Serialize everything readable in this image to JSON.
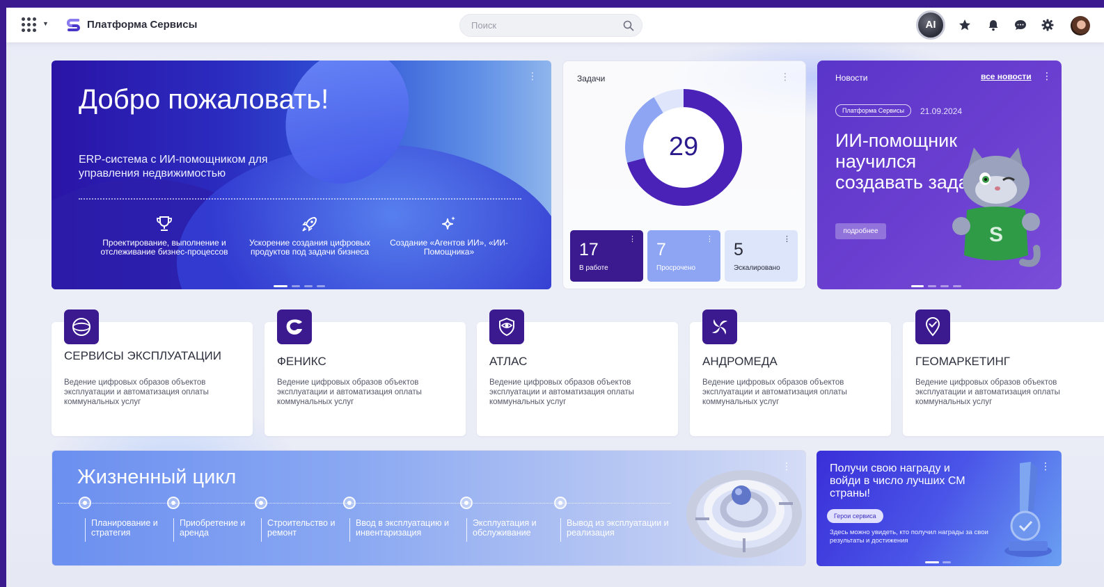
{
  "header": {
    "brand_name": "Платформа Сервисы",
    "search_placeholder": "Поиск",
    "ai_label": "AI",
    "icons": [
      "apps-grid-icon",
      "star-icon",
      "bell-icon",
      "chat-icon",
      "gear-icon"
    ]
  },
  "hero": {
    "title": "Добро пожаловать!",
    "subtitle": "ERP-система с ИИ-помощником для управления недвижимостью",
    "features": [
      {
        "icon": "trophy-icon",
        "label": "Проектирование, выполнение и отслеживание бизнес-процессов"
      },
      {
        "icon": "rocket-icon",
        "label": "Ускорение создания цифровых продуктов под задачи бизнеса"
      },
      {
        "icon": "sparkle-icon",
        "label": "Создание «Агентов ИИ», «ИИ-Помощника»"
      }
    ],
    "slides": 4,
    "active_slide": 1
  },
  "tasks": {
    "title": "Задачи",
    "total": "29",
    "stats": [
      {
        "value": "17",
        "label": "В работе",
        "bg": "#3b1a8f",
        "color": "#ffffff"
      },
      {
        "value": "7",
        "label": "Просрочено",
        "bg": "#8ea5f3",
        "color": "#ffffff"
      },
      {
        "value": "5",
        "label": "Эскалировано",
        "bg": "#dde5fb",
        "color": "#2b2e3a"
      }
    ]
  },
  "news": {
    "title": "Новости",
    "all_link": "все новости",
    "tag": "Платформа Сервисы",
    "date": "21.09.2024",
    "headline": "ИИ-помощник научился создавать задачи",
    "more_button": "подробнее",
    "slides": 4,
    "active_slide": 1
  },
  "services": [
    {
      "name": "СЕРВИСЫ ЭКСПЛУАТАЦИИ",
      "desc": "Ведение цифровых образов объектов эксплуатации и автоматизация оплаты коммунальных услуг",
      "icon": "globe-icon"
    },
    {
      "name": "ФЕНИКС",
      "desc": "Ведение цифровых образов объектов эксплуатации и автоматизация оплаты коммунальных услуг",
      "icon": "phoenix-icon"
    },
    {
      "name": "АТЛАС",
      "desc": "Ведение цифровых образов объектов эксплуатации и автоматизация оплаты коммунальных услуг",
      "icon": "eye-shield-icon"
    },
    {
      "name": "АНДРОМЕДА",
      "desc": "Ведение цифровых образов объектов эксплуатации и автоматизация оплаты коммунальных услуг",
      "icon": "swirl-icon"
    },
    {
      "name": "ГЕОМАРКЕТИНГ",
      "desc": "Ведение цифровых образов объектов эксплуатации и автоматизация оплаты коммунальных услуг",
      "icon": "geo-pin-icon"
    }
  ],
  "lifecycle": {
    "title": "Жизненный цикл",
    "steps": [
      "Планирование и стратегия",
      "Приобретение и аренда",
      "Строительство и ремонт",
      "Ввод в эксплуатацию и инвентаризация",
      "Эксплуатация и обслуживание",
      "Вывод из эксплуатации и реализация"
    ]
  },
  "reward": {
    "title": "Получи свою награду и войди в число лучших СМ страны!",
    "button": "Герои сервиса",
    "desc": "Здесь можно увидеть, кто получил награды за свои результаты и достижения",
    "slides": 2,
    "active_slide": 1
  }
}
